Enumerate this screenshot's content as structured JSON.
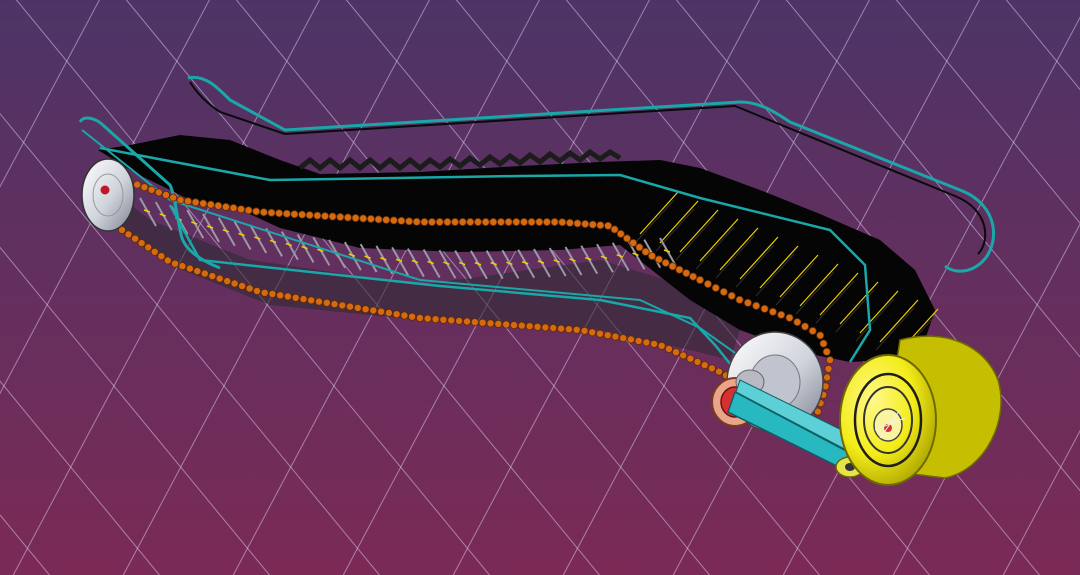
{
  "viewport": {
    "background_top": "#4d3467",
    "background_bottom": "#7b2a55",
    "grid_color": "#d7c8ef"
  },
  "model": {
    "parts": [
      "step-band",
      "chain-links",
      "handrail",
      "drive-sprocket",
      "return-sprocket",
      "motor",
      "drive-belt",
      "drive-pulley"
    ],
    "colors": {
      "steps": "#050505",
      "step_edge": "#2a2a2a",
      "chain": "#d66a10",
      "handrail": "#1aa7a8",
      "motor": "#f3ec17",
      "motor_shade": "#a7a000",
      "pulley": "#d63030",
      "belt": "#27b8c0",
      "sprocket": "#cfd3db",
      "yellow_lines": "#f0d000"
    }
  }
}
